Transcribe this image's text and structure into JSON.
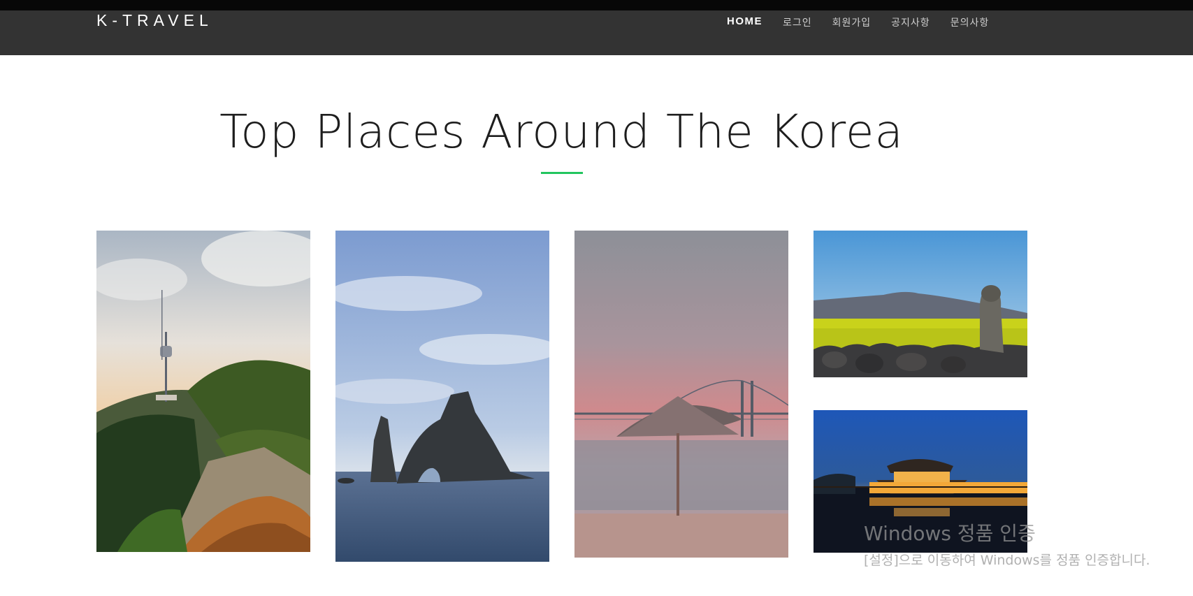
{
  "brand": "K-TRAVEL",
  "nav": [
    "HOME",
    "로그인",
    "회원가입",
    "공지사항",
    "문의사항"
  ],
  "hero": {
    "title": "Top Places Around The Korea"
  },
  "accent_color": "#22c55e",
  "places": [
    {
      "name": "seoul-tower-photo"
    },
    {
      "name": "sea-rock-photo"
    },
    {
      "name": "bridge-beach-photo"
    },
    {
      "name": "jeju-dol-hareubang-photo"
    },
    {
      "name": "palace-night-photo"
    }
  ],
  "watermark": {
    "title": "Windows 정품 인증",
    "subtitle": "[설정]으로 이동하여 Windows를 정품 인증합니다."
  }
}
